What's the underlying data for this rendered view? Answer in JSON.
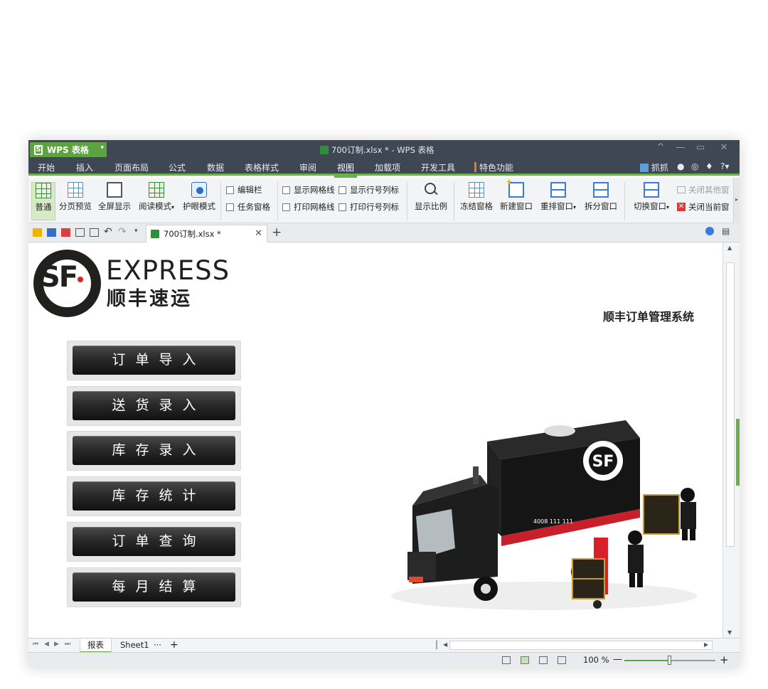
{
  "app": {
    "button_label": "WPS 表格",
    "logo_letter": "S",
    "window_title": "700订制.xlsx * - WPS 表格"
  },
  "window_controls": [
    "^",
    "—",
    "▭",
    "✕"
  ],
  "menu": {
    "tabs": [
      "开始",
      "插入",
      "页面布局",
      "公式",
      "数据",
      "表格样式",
      "审阅",
      "视图",
      "加载项",
      "开发工具",
      "特色功能"
    ],
    "active": "视图",
    "right": {
      "grab": "抓抓",
      "help": "?"
    }
  },
  "ribbon": {
    "buttons": [
      {
        "label": "普通"
      },
      {
        "label": "分页预览"
      },
      {
        "label": "全屏显示"
      },
      {
        "label": "阅读模式"
      },
      {
        "label": "护眼模式"
      }
    ],
    "checkboxes": {
      "edit_bar": "编辑栏",
      "task_pane": "任务窗格",
      "show_gridlines": "显示网格线",
      "print_gridlines": "打印网格线",
      "show_headers": "显示行号列标",
      "print_headers": "打印行号列标"
    },
    "zoom_button": "显示比例",
    "window_buttons": [
      {
        "label": "冻结窗格"
      },
      {
        "label": "新建窗口"
      },
      {
        "label": "重排窗口"
      },
      {
        "label": "拆分窗口"
      },
      {
        "label": "切换窗口"
      }
    ],
    "close_others": "关闭其他窗",
    "close_current": "关闭当前窗"
  },
  "document_tab": {
    "name": "700订制.xlsx *",
    "close": "✕",
    "add": "+"
  },
  "sheet_content": {
    "logo": {
      "letters": "SF",
      "english": "EXPRESS",
      "chinese": "顺丰速运"
    },
    "system_title": "顺丰订单管理系统",
    "menu_buttons": [
      "订单导入",
      "送货录入",
      "库存录入",
      "库存统计",
      "订单查询",
      "每月结算"
    ],
    "truck_phone": "4008 111 111"
  },
  "sheet_tabs": {
    "tabs": [
      "报表",
      "Sheet1"
    ],
    "active": "报表",
    "more": "···",
    "add": "+"
  },
  "status": {
    "zoom_text": "100 %",
    "zoom_percent": 100,
    "zoom_fraction": 0.5
  },
  "colors": {
    "accent": "#6ab04c",
    "titlebar": "#3f4654",
    "sf_red": "#d9261c",
    "sf_black": "#221f1f"
  }
}
